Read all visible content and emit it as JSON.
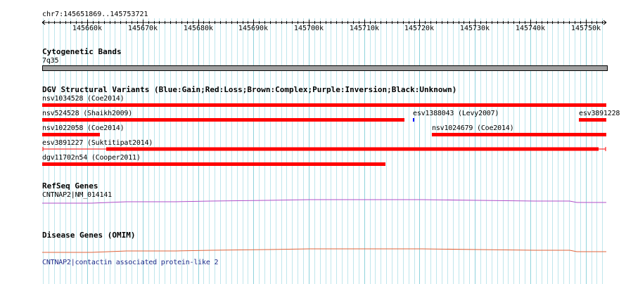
{
  "ruler": {
    "region": "chr7:145651869..145753721",
    "ticks": [
      "145660k",
      "145670k",
      "145680k",
      "145690k",
      "145700k",
      "145710k",
      "145720k",
      "145730k",
      "145740k",
      "145750k"
    ]
  },
  "tracks": {
    "cytoband": {
      "title": "Cytogenetic Bands",
      "band": "7q35"
    },
    "dgv": {
      "title": "DGV Structural Variants (Blue:Gain;Red:Loss;Brown:Complex;Purple:Inversion;Black:Unknown)",
      "features": [
        {
          "label": "nsv1034528  (Coe2014)",
          "color": "#ff0000"
        },
        {
          "label": "nsv524528  (Shaikh2009)",
          "color": "#ff0000"
        },
        {
          "label": "esv1388043  (Levy2007)",
          "color": "#0000ff"
        },
        {
          "label": "esv3891228",
          "color": "#ff0000"
        },
        {
          "label": "nsv1022058  (Coe2014)",
          "color": "#ff0000"
        },
        {
          "label": "nsv1024679  (Coe2014)",
          "color": "#ff0000"
        },
        {
          "label": "esv3891227  (Suktitipat2014)",
          "color": "#ff0000"
        },
        {
          "label": "dgv11702n54  (Cooper2011)",
          "color": "#ff0000"
        }
      ]
    },
    "refseq": {
      "title": "RefSeq Genes",
      "gene": "CNTNAP2|NM_014141",
      "color": "#b04fc8"
    },
    "omim": {
      "title": "Disease Genes (OMIM)",
      "gene": "CNTNAP2|contactin associated protein-like 2",
      "color": "#e0643c"
    }
  }
}
